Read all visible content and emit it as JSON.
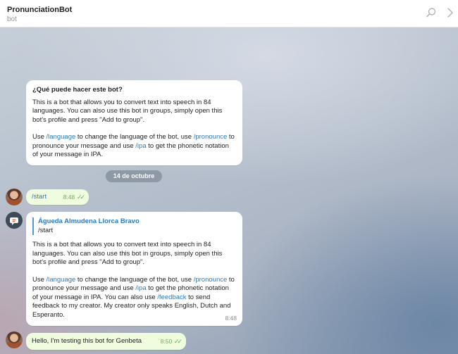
{
  "header": {
    "title": "PronunciationBot",
    "subtitle": "bot"
  },
  "intro": {
    "heading": "¿Qué puede hacer este bot?",
    "para1": "This is a bot that allows you to convert text into speech in 84 languages. You can also use this bot in groups, simply open this bot's profile and press \"Add to group\".",
    "use": "Use ",
    "cmd_language": "/language",
    "t1": " to change the language of the bot, use ",
    "cmd_pronounce": "/pronounce",
    "t2": " to pronounce your message and use ",
    "cmd_ipa": "/ipa",
    "t3": " to get the phonetic notation of your message in IPA."
  },
  "date_separator": "14 de octubre",
  "msg_start": {
    "text": "/start",
    "time": "8:48"
  },
  "msg_bot": {
    "reply_name": "Águeda Almudena Llorca Bravo",
    "reply_text": "/start",
    "para1": "This is a bot that allows you to convert text into speech in 84 languages. You can also use this bot in groups, simply open this bot's profile and press \"Add to group\".",
    "use": "Use ",
    "cmd_language": "/language",
    "t1": " to change the language of the bot, use ",
    "cmd_pronounce": "/pronounce",
    "t2": " to pronounce your message and use ",
    "cmd_ipa": "/ipa",
    "t3": " to get the phonetic notation of your message in IPA. You can also use ",
    "cmd_feedback": "/feedback",
    "t4": " to send feedback to my creator. My creator only speaks English, Dutch and Esperanto.",
    "time": "8:48"
  },
  "msg_hello": {
    "text": "Hello, I'm testing this bot for Genbeta",
    "time": "8:50"
  },
  "icons": {
    "search": "search-icon",
    "chevron": "chevron-right-icon",
    "read": "double-check-icon"
  }
}
